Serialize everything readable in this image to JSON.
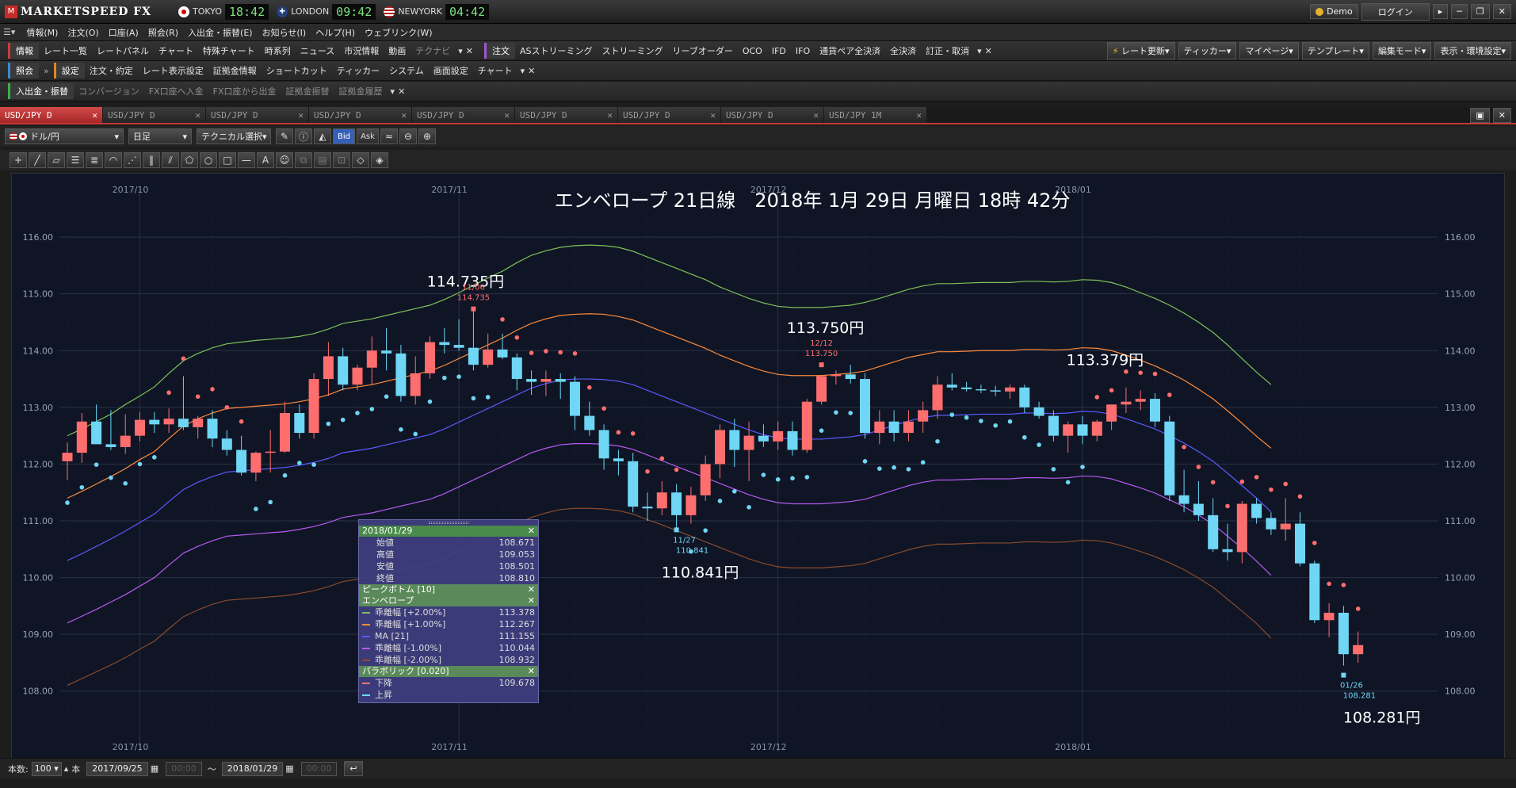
{
  "app": {
    "title": "MARKETSPEED FX",
    "account_mode": "Demo",
    "login": "ログイン"
  },
  "clocks": [
    {
      "city": "TOKYO",
      "time": "18:42"
    },
    {
      "city": "LONDON",
      "time": "09:42"
    },
    {
      "city": "NEWYORK",
      "time": "04:42"
    }
  ],
  "menu": [
    "情報(M)",
    "注文(O)",
    "口座(A)",
    "照会(R)",
    "入出金・振替(E)",
    "お知らせ(I)",
    "ヘルプ(H)",
    "ウェブリンク(W)"
  ],
  "toolbar1": {
    "group_label": "情報",
    "items": [
      "レート一覧",
      "レートパネル",
      "チャート",
      "特殊チャート",
      "時系列",
      "ニュース",
      "市況情報",
      "動画"
    ],
    "disabled": [
      "テクナビ"
    ],
    "group2_label": "注文",
    "items2": [
      "ASストリーミング",
      "ストリーミング",
      "リーブオーダー",
      "OCO",
      "IFD",
      "IFO",
      "通貨ペア全決済",
      "全決済",
      "訂正・取消"
    ],
    "right_buttons": [
      "レート更新▾",
      "ティッカー▾",
      "マイページ▾",
      "テンプレート▾",
      "編集モード▾",
      "表示・環境設定▾"
    ]
  },
  "toolbar2": {
    "group_label": "照会",
    "group2_label": "設定",
    "items": [
      "注文・約定",
      "レート表示設定",
      "証拠金情報",
      "ショートカット",
      "ティッカー",
      "システム",
      "画面設定",
      "チャート"
    ]
  },
  "toolbar3": {
    "group_label": "入出金・振替",
    "items": [
      "コンバージョン",
      "FX口座へ入金",
      "FX口座から出金",
      "証拠金振替",
      "証拠金履歴"
    ]
  },
  "tabs": [
    "USD/JPY D",
    "USD/JPY D",
    "USD/JPY D",
    "USD/JPY D",
    "USD/JPY D",
    "USD/JPY D",
    "USD/JPY D",
    "USD/JPY D",
    "USD/JPY 1M"
  ],
  "controls": {
    "pair": "ドル/円",
    "period": "日足",
    "technical": "テクニカル選択",
    "bid": "Bid",
    "ask": "Ask"
  },
  "status": {
    "count_label": "本数:",
    "count": "100",
    "unit": "本",
    "from_date": "2017/09/25",
    "to_date": "2018/01/29",
    "from_time": "00:00",
    "to_time": "00:00",
    "tilde": "〜"
  },
  "chart_data": {
    "type": "candlestick",
    "title": "エンベロープ 21日線　2018年 1月 29日 月曜日 18時 42分",
    "y_ticks": [
      "116.00",
      "115.00",
      "114.00",
      "113.00",
      "112.00",
      "111.00",
      "110.00",
      "109.00",
      "108.00"
    ],
    "ylim": [
      107.2,
      116.7
    ],
    "x_months": [
      "2017/10",
      "2017/11",
      "2017/12",
      "2018/01"
    ],
    "x_month_index": [
      5,
      27,
      49,
      70
    ],
    "candles": [
      [
        112.05,
        112.38,
        111.72,
        112.2
      ],
      [
        112.2,
        112.9,
        112.02,
        112.75
      ],
      [
        112.75,
        113.05,
        112.45,
        112.35
      ],
      [
        112.35,
        112.95,
        112.25,
        112.3
      ],
      [
        112.3,
        112.88,
        112.18,
        112.5
      ],
      [
        112.5,
        112.92,
        112.4,
        112.78
      ],
      [
        112.78,
        112.92,
        112.55,
        112.7
      ],
      [
        112.7,
        112.98,
        112.55,
        112.8
      ],
      [
        112.8,
        113.55,
        112.6,
        112.65
      ],
      [
        112.65,
        112.85,
        112.45,
        112.8
      ],
      [
        112.8,
        112.95,
        112.3,
        112.45
      ],
      [
        112.45,
        112.6,
        112.15,
        112.25
      ],
      [
        112.25,
        112.5,
        111.8,
        111.85
      ],
      [
        111.85,
        112.22,
        111.7,
        112.2
      ],
      [
        112.2,
        112.6,
        111.85,
        112.22
      ],
      [
        112.22,
        113.1,
        112.2,
        112.9
      ],
      [
        112.9,
        113.05,
        112.45,
        112.55
      ],
      [
        112.55,
        113.6,
        112.45,
        113.5
      ],
      [
        113.5,
        114.15,
        113.2,
        113.9
      ],
      [
        113.9,
        114.05,
        113.3,
        113.4
      ],
      [
        113.4,
        113.75,
        113.3,
        113.7
      ],
      [
        113.7,
        114.25,
        113.4,
        114.0
      ],
      [
        114.0,
        114.4,
        113.65,
        113.95
      ],
      [
        113.95,
        114.1,
        113.1,
        113.2
      ],
      [
        113.2,
        113.9,
        113.05,
        113.6
      ],
      [
        113.6,
        114.25,
        113.5,
        114.15
      ],
      [
        114.15,
        114.4,
        113.95,
        114.1
      ],
      [
        114.1,
        114.55,
        114.0,
        114.05
      ],
      [
        114.05,
        114.74,
        113.65,
        113.75
      ],
      [
        113.75,
        114.3,
        113.7,
        114.02
      ],
      [
        114.02,
        114.3,
        113.85,
        113.88
      ],
      [
        113.88,
        113.95,
        113.3,
        113.5
      ],
      [
        113.5,
        113.65,
        113.22,
        113.45
      ],
      [
        113.45,
        113.65,
        113.2,
        113.5
      ],
      [
        113.5,
        113.6,
        113.15,
        113.45
      ],
      [
        113.45,
        113.55,
        112.6,
        112.85
      ],
      [
        112.85,
        113.1,
        112.5,
        112.6
      ],
      [
        112.6,
        112.7,
        111.9,
        112.1
      ],
      [
        112.1,
        112.25,
        111.8,
        112.05
      ],
      [
        112.05,
        112.2,
        111.15,
        111.25
      ],
      [
        111.25,
        111.5,
        111.0,
        111.22
      ],
      [
        111.22,
        111.7,
        111.1,
        111.5
      ],
      [
        111.5,
        111.65,
        110.84,
        111.1
      ],
      [
        111.1,
        111.6,
        110.95,
        111.45
      ],
      [
        111.45,
        112.15,
        111.35,
        112.0
      ],
      [
        112.0,
        112.7,
        111.75,
        112.6
      ],
      [
        112.6,
        112.8,
        111.95,
        112.25
      ],
      [
        112.25,
        112.75,
        111.7,
        112.5
      ],
      [
        112.5,
        112.7,
        112.3,
        112.4
      ],
      [
        112.4,
        112.75,
        112.25,
        112.58
      ],
      [
        112.58,
        112.75,
        112.15,
        112.25
      ],
      [
        112.25,
        113.15,
        112.2,
        113.1
      ],
      [
        113.1,
        113.55,
        113.05,
        113.55
      ],
      [
        113.55,
        113.65,
        113.4,
        113.58
      ],
      [
        113.58,
        113.75,
        113.42,
        113.5
      ],
      [
        113.5,
        113.6,
        112.45,
        112.55
      ],
      [
        112.55,
        112.95,
        112.35,
        112.75
      ],
      [
        112.75,
        112.95,
        112.4,
        112.55
      ],
      [
        112.55,
        112.95,
        112.4,
        112.75
      ],
      [
        112.75,
        113.1,
        112.55,
        112.95
      ],
      [
        112.95,
        113.55,
        112.8,
        113.4
      ],
      [
        113.4,
        113.6,
        113.3,
        113.35
      ],
      [
        113.35,
        113.45,
        113.28,
        113.32
      ],
      [
        113.32,
        113.4,
        113.25,
        113.3
      ],
      [
        113.3,
        113.38,
        113.2,
        113.28
      ],
      [
        113.28,
        113.4,
        113.15,
        113.35
      ],
      [
        113.35,
        113.4,
        112.9,
        113.0
      ],
      [
        113.0,
        113.1,
        112.8,
        112.85
      ],
      [
        112.85,
        112.95,
        112.4,
        112.5
      ],
      [
        112.5,
        112.75,
        112.2,
        112.7
      ],
      [
        112.7,
        112.85,
        112.35,
        112.5
      ],
      [
        112.5,
        112.78,
        112.4,
        112.75
      ],
      [
        112.75,
        113.05,
        112.6,
        113.05
      ],
      [
        113.05,
        113.35,
        112.9,
        113.1
      ],
      [
        113.1,
        113.3,
        112.95,
        113.15
      ],
      [
        113.15,
        113.25,
        112.65,
        112.75
      ],
      [
        112.75,
        112.85,
        111.35,
        111.45
      ],
      [
        111.45,
        111.9,
        111.15,
        111.3
      ],
      [
        111.3,
        111.7,
        111.0,
        111.1
      ],
      [
        111.1,
        111.4,
        110.45,
        110.5
      ],
      [
        110.5,
        110.95,
        110.3,
        110.45
      ],
      [
        110.45,
        111.35,
        110.25,
        111.3
      ],
      [
        111.3,
        111.4,
        110.95,
        111.05
      ],
      [
        111.05,
        111.15,
        110.75,
        110.85
      ],
      [
        110.85,
        111.4,
        110.65,
        110.95
      ],
      [
        110.95,
        111.15,
        110.2,
        110.25
      ],
      [
        110.25,
        110.3,
        109.2,
        109.25
      ],
      [
        109.25,
        109.55,
        108.95,
        109.38
      ],
      [
        109.38,
        109.5,
        108.45,
        108.65
      ],
      [
        108.65,
        109.05,
        108.5,
        108.81
      ]
    ],
    "envelope": {
      "plus2": [
        112.5,
        112.62,
        112.75,
        112.88,
        113.05,
        113.2,
        113.36,
        113.6,
        113.82,
        113.95,
        114.05,
        114.12,
        114.15,
        114.18,
        114.2,
        114.22,
        114.25,
        114.3,
        114.38,
        114.48,
        114.52,
        114.56,
        114.62,
        114.68,
        114.74,
        114.8,
        114.9,
        115.02,
        115.15,
        115.28,
        115.4,
        115.55,
        115.68,
        115.76,
        115.82,
        115.85,
        115.86,
        115.85,
        115.82,
        115.75,
        115.65,
        115.55,
        115.45,
        115.35,
        115.25,
        115.12,
        115.02,
        114.92,
        114.84,
        114.78,
        114.76,
        114.76,
        114.76,
        114.78,
        114.8,
        114.85,
        114.92,
        115.0,
        115.08,
        115.14,
        115.18,
        115.18,
        115.19,
        115.2,
        115.2,
        115.2,
        115.22,
        115.22,
        115.21,
        115.22,
        115.25,
        115.24,
        115.2,
        115.12,
        115.02,
        114.92,
        114.8,
        114.66,
        114.5,
        114.32,
        114.1,
        113.86,
        113.62,
        113.4
      ],
      "plus1": [
        111.4,
        111.52,
        111.65,
        111.78,
        111.92,
        112.08,
        112.22,
        112.45,
        112.67,
        112.8,
        112.9,
        112.98,
        113.0,
        113.02,
        113.04,
        113.06,
        113.1,
        113.15,
        113.22,
        113.32,
        113.36,
        113.4,
        113.46,
        113.52,
        113.58,
        113.64,
        113.74,
        113.86,
        113.98,
        114.1,
        114.22,
        114.36,
        114.48,
        114.56,
        114.62,
        114.64,
        114.65,
        114.64,
        114.6,
        114.54,
        114.44,
        114.34,
        114.24,
        114.14,
        114.04,
        113.92,
        113.82,
        113.72,
        113.64,
        113.58,
        113.56,
        113.56,
        113.56,
        113.58,
        113.6,
        113.64,
        113.72,
        113.8,
        113.88,
        113.93,
        113.98,
        113.98,
        113.99,
        114.0,
        114.0,
        114.0,
        114.02,
        114.02,
        114.01,
        114.02,
        114.05,
        114.04,
        114.0,
        113.92,
        113.83,
        113.73,
        113.61,
        113.48,
        113.32,
        113.15,
        112.94,
        112.72,
        112.49,
        112.28
      ],
      "ma": [
        110.3,
        110.42,
        110.55,
        110.68,
        110.82,
        110.97,
        111.12,
        111.34,
        111.55,
        111.68,
        111.78,
        111.86,
        111.88,
        111.9,
        111.92,
        111.94,
        111.98,
        112.03,
        112.1,
        112.2,
        112.24,
        112.28,
        112.34,
        112.4,
        112.46,
        112.52,
        112.62,
        112.74,
        112.86,
        112.98,
        113.1,
        113.22,
        113.34,
        113.42,
        113.48,
        113.5,
        113.5,
        113.49,
        113.46,
        113.4,
        113.3,
        113.2,
        113.1,
        113.0,
        112.9,
        112.8,
        112.7,
        112.6,
        112.52,
        112.46,
        112.44,
        112.44,
        112.44,
        112.46,
        112.48,
        112.52,
        112.6,
        112.68,
        112.76,
        112.82,
        112.86,
        112.86,
        112.87,
        112.88,
        112.88,
        112.88,
        112.9,
        112.9,
        112.89,
        112.9,
        112.93,
        112.92,
        112.88,
        112.8,
        112.71,
        112.62,
        112.5,
        112.37,
        112.22,
        112.05,
        111.84,
        111.62,
        111.4,
        111.16
      ],
      "minus1": [
        109.2,
        109.32,
        109.44,
        109.57,
        109.7,
        109.85,
        110.0,
        110.22,
        110.43,
        110.55,
        110.65,
        110.73,
        110.75,
        110.77,
        110.79,
        110.81,
        110.85,
        110.9,
        110.97,
        111.06,
        111.1,
        111.14,
        111.2,
        111.26,
        111.32,
        111.38,
        111.48,
        111.6,
        111.72,
        111.84,
        111.96,
        112.08,
        112.2,
        112.28,
        112.34,
        112.36,
        112.36,
        112.35,
        112.32,
        112.26,
        112.16,
        112.06,
        111.96,
        111.86,
        111.76,
        111.66,
        111.56,
        111.46,
        111.38,
        111.32,
        111.3,
        111.3,
        111.3,
        111.32,
        111.34,
        111.38,
        111.46,
        111.54,
        111.62,
        111.68,
        111.72,
        111.72,
        111.73,
        111.74,
        111.74,
        111.74,
        111.76,
        111.76,
        111.75,
        111.76,
        111.79,
        111.78,
        111.74,
        111.66,
        111.58,
        111.49,
        111.37,
        111.25,
        111.1,
        110.94,
        110.73,
        110.52,
        110.29,
        110.04
      ],
      "minus2": [
        108.1,
        108.22,
        108.34,
        108.46,
        108.59,
        108.74,
        108.88,
        109.1,
        109.31,
        109.43,
        109.53,
        109.6,
        109.62,
        109.64,
        109.66,
        109.68,
        109.72,
        109.77,
        109.84,
        109.93,
        109.97,
        110.01,
        110.07,
        110.13,
        110.19,
        110.25,
        110.35,
        110.47,
        110.59,
        110.71,
        110.83,
        110.95,
        111.06,
        111.14,
        111.2,
        111.22,
        111.22,
        111.21,
        111.18,
        111.12,
        111.02,
        110.93,
        110.83,
        110.73,
        110.63,
        110.53,
        110.43,
        110.33,
        110.25,
        110.19,
        110.17,
        110.17,
        110.17,
        110.19,
        110.21,
        110.25,
        110.33,
        110.41,
        110.49,
        110.55,
        110.59,
        110.59,
        110.6,
        110.61,
        110.61,
        110.61,
        110.63,
        110.63,
        110.62,
        110.63,
        110.66,
        110.65,
        110.61,
        110.54,
        110.46,
        110.37,
        110.26,
        110.14,
        109.99,
        109.83,
        109.62,
        109.41,
        109.19,
        108.93
      ]
    },
    "annotations": [
      {
        "text": "114.735円",
        "i": 28,
        "v": 114.735,
        "dx": -10,
        "dy": -28
      },
      {
        "text": "113.750円",
        "i": 52,
        "v": 113.75,
        "dx": 5,
        "dy": -40
      },
      {
        "text": "113.379円",
        "i": 68,
        "v": 113.379,
        "dx": 65,
        "dy": -26
      },
      {
        "text": "110.841円",
        "i": 42,
        "v": 110.841,
        "dx": 30,
        "dy": 60
      },
      {
        "text": "108.281円",
        "i": 89,
        "v": 108.281,
        "dx": 30,
        "dy": 60
      }
    ],
    "peaks": [
      {
        "date": "11/06",
        "value": "114.735",
        "i": 28,
        "v": 114.735,
        "pos": "top"
      },
      {
        "date": "12/12",
        "value": "113.750",
        "i": 52,
        "v": 113.75,
        "pos": "top"
      },
      {
        "date": "11/27",
        "value": "110.841",
        "i": 42,
        "v": 110.841,
        "pos": "bottom"
      },
      {
        "date": "01/26",
        "value": "108.281",
        "i": 88,
        "v": 108.281,
        "pos": "bottom"
      }
    ]
  },
  "infobox": {
    "date": "2018/01/29",
    "ohlc": [
      {
        "label": "始値",
        "value": "108.671"
      },
      {
        "label": "高値",
        "value": "109.053"
      },
      {
        "label": "安値",
        "value": "108.501"
      },
      {
        "label": "終値",
        "value": "108.810"
      }
    ],
    "peak_header": "ピークボトム [10]",
    "env_header": "エンベロープ",
    "env_rows": [
      {
        "label": "乖離幅 [+2.00%]",
        "value": "113.378"
      },
      {
        "label": "乖離幅 [+1.00%]",
        "value": "112.267"
      },
      {
        "label": "MA [21]",
        "value": "111.155"
      },
      {
        "label": "乖離幅 [-1.00%]",
        "value": "110.044"
      },
      {
        "label": "乖離幅 [-2.00%]",
        "value": "108.932"
      }
    ],
    "sar_header": "パラボリック [0.020]",
    "sar_rows": [
      {
        "label": "下降",
        "value": "109.678"
      },
      {
        "label": "上昇",
        "value": ""
      }
    ]
  },
  "colors": {
    "up": "#ff6e6e",
    "down": "#6fd6f5",
    "plus2": "#7fc25a",
    "plus1": "#ff8a3a",
    "ma": "#5a5aff",
    "minus1": "#b65af0",
    "minus2": "#8b4a2a",
    "sar_down": "#ff6e6e",
    "sar_up": "#6fd6f5"
  }
}
